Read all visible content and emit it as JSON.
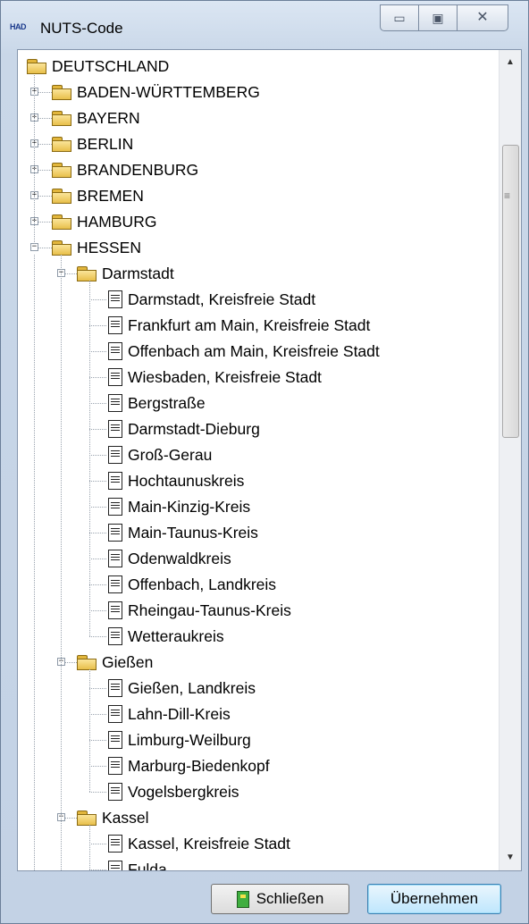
{
  "window": {
    "title": "NUTS-Code",
    "app_logo": "HAD",
    "controls": {
      "minimize": "▭",
      "maximize": "▣",
      "close": "✕"
    }
  },
  "tree": {
    "root": "DEUTSCHLAND",
    "states": [
      "BADEN-WÜRTTEMBERG",
      "BAYERN",
      "BERLIN",
      "BRANDENBURG",
      "BREMEN",
      "HAMBURG",
      "HESSEN"
    ],
    "hessen_regions": [
      {
        "name": "Darmstadt",
        "districts": [
          "Darmstadt, Kreisfreie Stadt",
          "Frankfurt am Main, Kreisfreie Stadt",
          "Offenbach am Main, Kreisfreie Stadt",
          "Wiesbaden, Kreisfreie Stadt",
          "Bergstraße",
          "Darmstadt-Dieburg",
          "Groß-Gerau",
          "Hochtaunuskreis",
          "Main-Kinzig-Kreis",
          "Main-Taunus-Kreis",
          "Odenwaldkreis",
          "Offenbach, Landkreis",
          "Rheingau-Taunus-Kreis",
          "Wetteraukreis"
        ]
      },
      {
        "name": "Gießen",
        "districts": [
          "Gießen, Landkreis",
          "Lahn-Dill-Kreis",
          "Limburg-Weilburg",
          "Marburg-Biedenkopf",
          "Vogelsbergkreis"
        ]
      },
      {
        "name": "Kassel",
        "districts": [
          "Kassel, Kreisfreie Stadt",
          "Fulda"
        ]
      }
    ]
  },
  "buttons": {
    "close_label": "Schließen",
    "apply_label": "Übernehmen"
  }
}
